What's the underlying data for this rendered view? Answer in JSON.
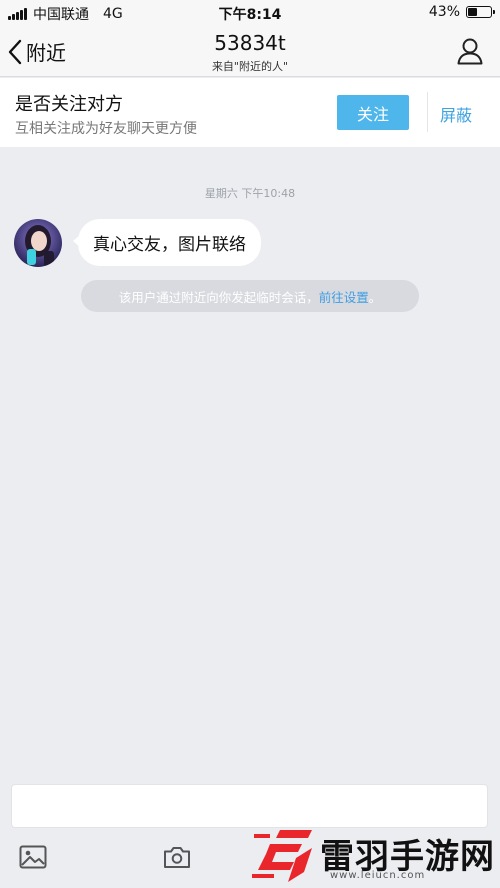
{
  "status_bar": {
    "carrier": "中国联通",
    "network": "4G",
    "time": "下午8:14",
    "battery_text": "43%",
    "battery_level": 0.43
  },
  "nav": {
    "back_label": "附近",
    "title": "53834t",
    "subtitle": "来自\"附近的人\""
  },
  "follow_bar": {
    "title": "是否关注对方",
    "subtitle": "互相关注成为好友聊天更方便",
    "follow_button": "关注",
    "block_button": "屏蔽"
  },
  "chat": {
    "timestamp": "星期六 下午10:48",
    "message": "真心交友，图片联络",
    "system_note_prefix": "该用户通过附近向你发起临时会话，",
    "system_note_link": "前往设置",
    "system_note_suffix": "。"
  },
  "toolbar": {
    "icons": [
      "image-icon",
      "camera-icon"
    ]
  },
  "watermark": {
    "brand": "雷羽手游网",
    "url": "www.leiucn.com"
  },
  "colors": {
    "accent": "#4fb6ec",
    "link": "#3f9ee0",
    "background": "#ebedf1",
    "logo_red": "#e8262b"
  }
}
